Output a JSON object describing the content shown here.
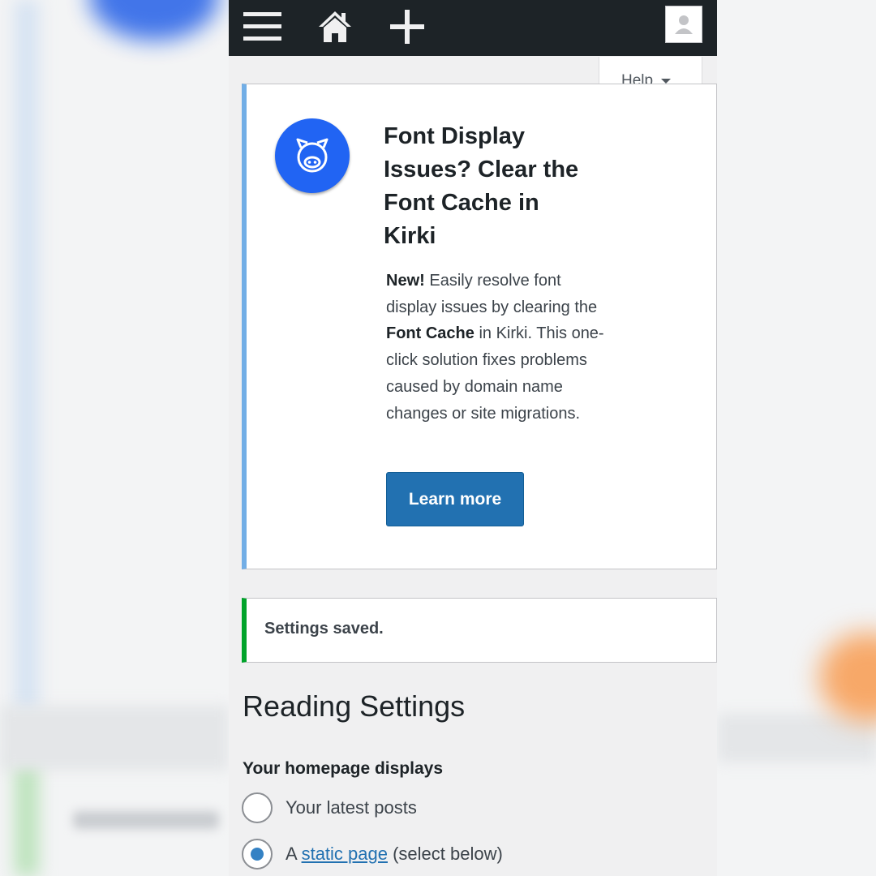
{
  "toolbar": {
    "menu_icon": "hamburger-menu-icon",
    "home_icon": "home-icon",
    "add_icon": "plus-icon",
    "account_icon": "user-avatar-icon"
  },
  "help_tab": {
    "label": "Help"
  },
  "notice": {
    "logo_icon": "pig-face-icon",
    "title": "Font Display Issues? Clear the Font Cache in Kirki",
    "body": {
      "new_label": "New!",
      "text_1": " Easily resolve font display issues by clearing the ",
      "bold_term": "Font Cache",
      "text_2": " in Kirki. This one-click solution fixes problems caused by domain name changes or site migrations."
    },
    "button_label": "Learn more"
  },
  "status": {
    "message": "Settings saved."
  },
  "page": {
    "title": "Reading Settings",
    "homepage_label": "Your homepage displays",
    "options": [
      {
        "label": "Your latest posts",
        "selected": false
      },
      {
        "prefix": "A ",
        "link": "static page",
        "suffix": " (select below)",
        "selected": true
      }
    ]
  },
  "colors": {
    "admin_bar": "#1d2327",
    "accent_blue": "#2271b1",
    "notice_info_border": "#72aee6",
    "notice_success_border": "#00a32a",
    "kirki_logo": "#2164f3"
  }
}
